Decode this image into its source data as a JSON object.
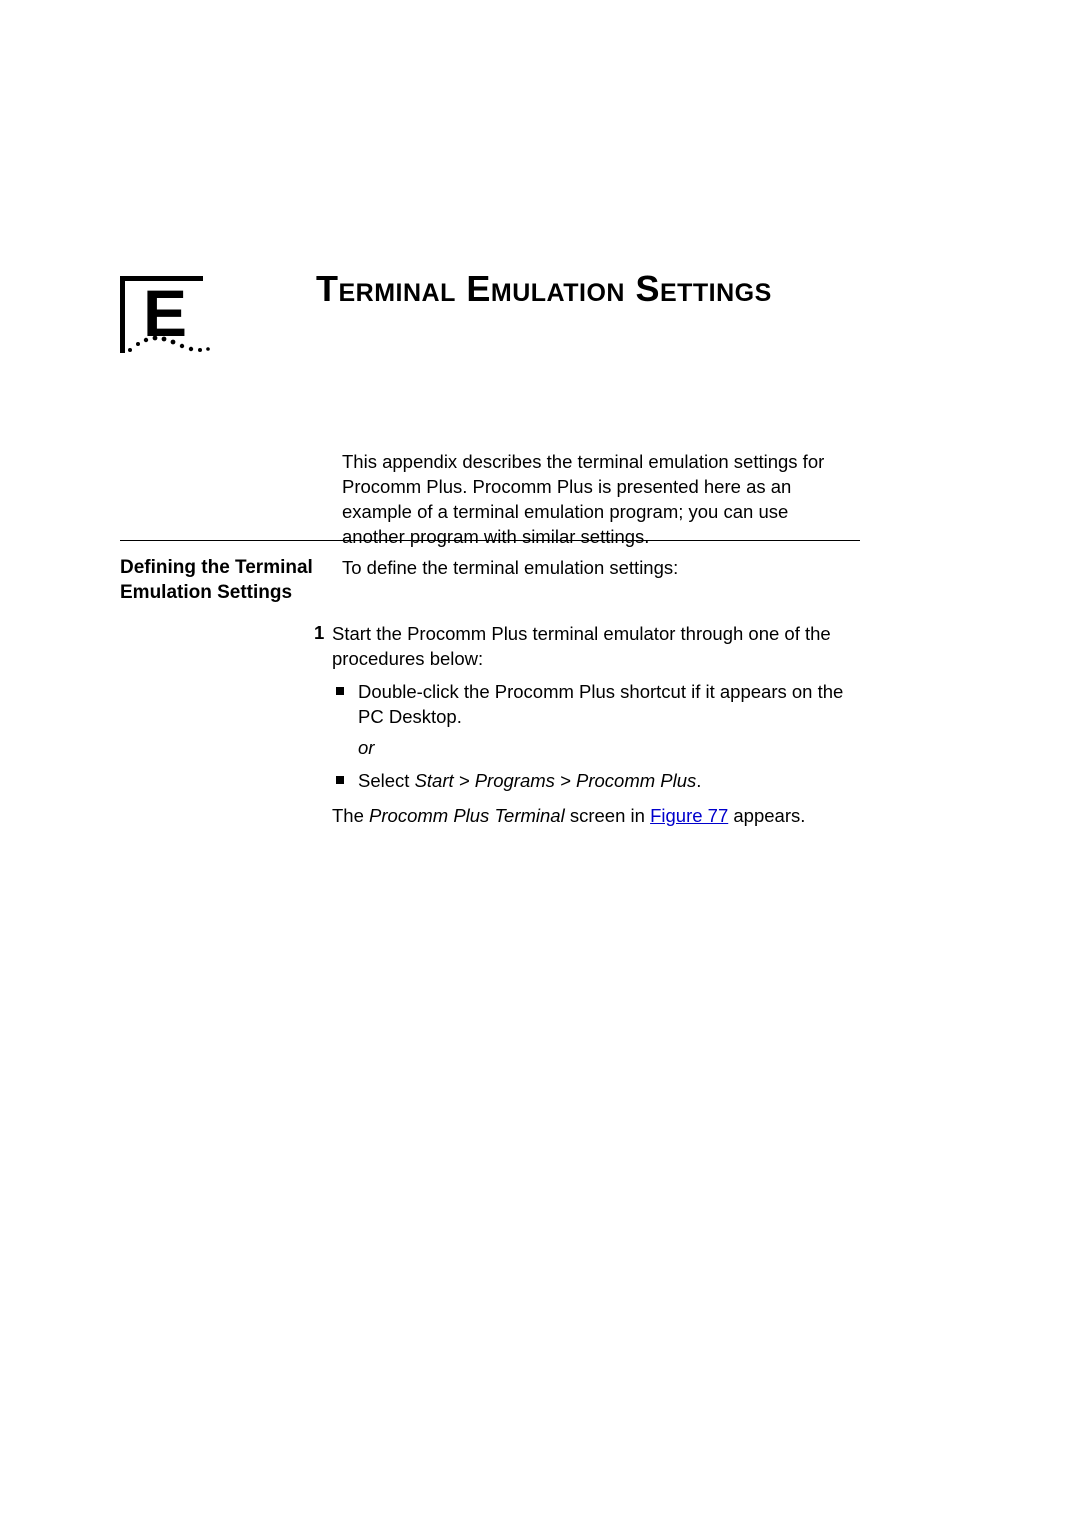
{
  "appendix_letter": "E",
  "title": "Terminal Emulation Settings",
  "intro": "This appendix describes the terminal emulation settings for Procomm Plus. Procomm Plus is presented here as an example of a terminal emulation program; you can use another program with similar settings.",
  "section_heading": "Defining the Terminal Emulation Settings",
  "lead_in": "To define the terminal emulation settings:",
  "step1": {
    "num": "1",
    "text": "Start the Procomm Plus terminal emulator through one of the procedures below:",
    "bullet_a": "Double-click the Procomm Plus shortcut if it appears on the PC Desktop.",
    "or": "or",
    "bullet_b_prefix": "Select ",
    "bullet_b_path": "Start > Programs > Procomm Plus",
    "bullet_b_suffix": ".",
    "result_prefix": "The ",
    "result_ital": "Procomm Plus Terminal",
    "result_mid": " screen in ",
    "result_link": "Figure 77",
    "result_suffix": " appears."
  }
}
